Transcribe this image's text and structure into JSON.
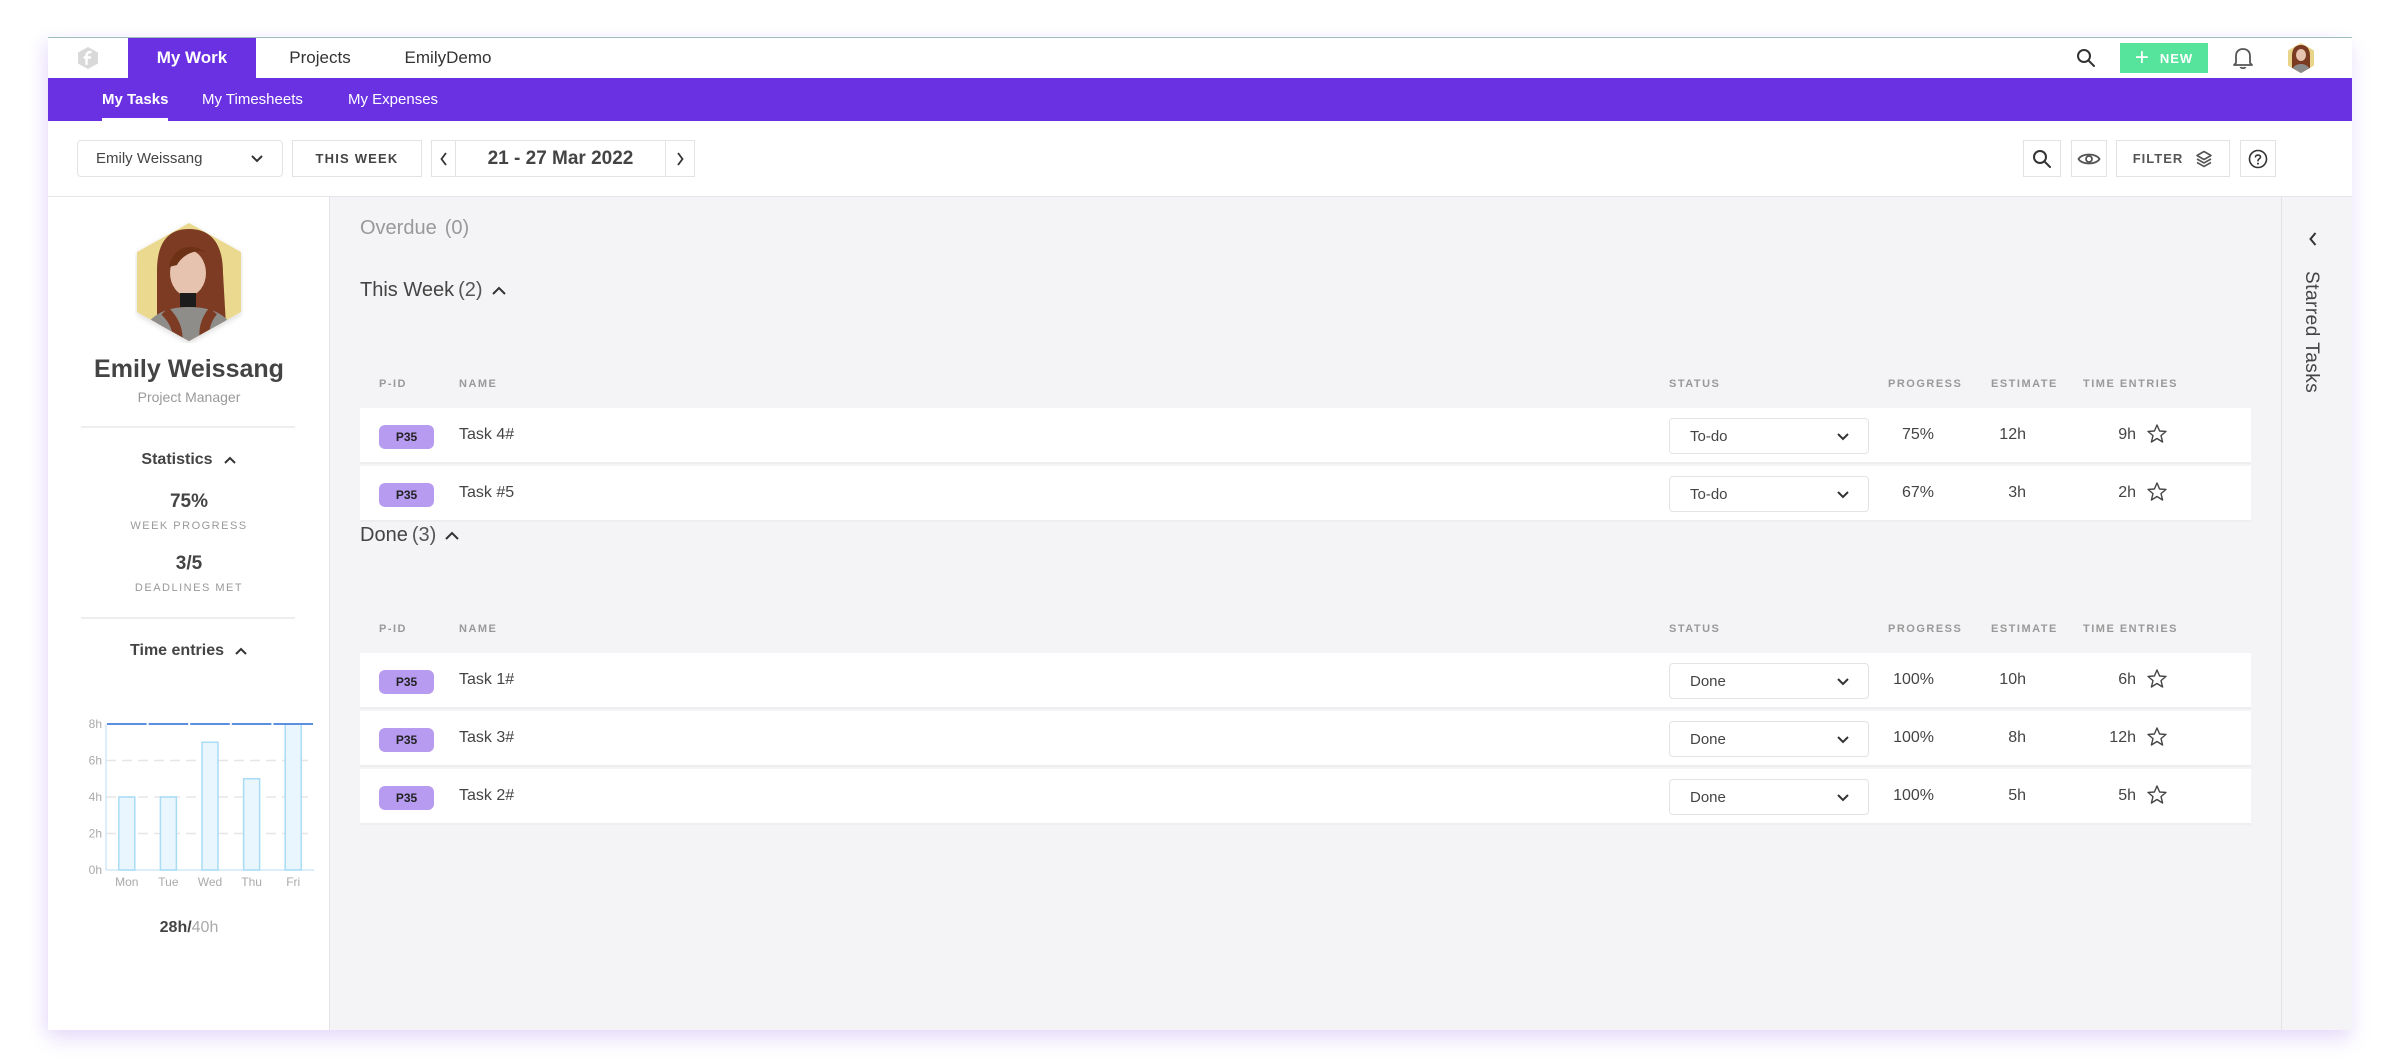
{
  "topnav": {
    "tabs": [
      {
        "label": "My Work",
        "active": true
      },
      {
        "label": "Projects",
        "active": false
      },
      {
        "label": "EmilyDemo",
        "active": false
      }
    ],
    "new_label": "NEW",
    "icons": [
      "search-icon",
      "plus-icon",
      "bell-icon",
      "user-avatar"
    ]
  },
  "subnav": {
    "tabs": [
      {
        "label": "My Tasks",
        "active": true
      },
      {
        "label": "My Timesheets",
        "active": false
      },
      {
        "label": "My Expenses",
        "active": false
      }
    ]
  },
  "toolbar": {
    "user_select": "Emily Weissang",
    "this_week_label": "THIS WEEK",
    "date_range": "21 - 27 Mar 2022",
    "filter_label": "FILTER"
  },
  "profile": {
    "name": "Emily Weissang",
    "role": "Project Manager",
    "statistics_title": "Statistics",
    "week_progress_value": "75%",
    "week_progress_label": "WEEK PROGRESS",
    "deadlines_value": "3/5",
    "deadlines_label": "DEADLINES MET",
    "time_entries_title": "Time entries",
    "total_logged": "28h/",
    "total_capacity": "40h"
  },
  "chart_data": {
    "type": "bar",
    "title": "Time entries",
    "categories": [
      "Mon",
      "Tue",
      "Wed",
      "Thu",
      "Fri"
    ],
    "values": [
      4,
      4,
      7,
      5,
      8
    ],
    "unit": "h",
    "yticks": [
      "0h",
      "2h",
      "4h",
      "6h",
      "8h"
    ],
    "ylim": [
      0,
      8
    ],
    "target_line": 8,
    "grid": true,
    "xlabel": "",
    "ylabel": ""
  },
  "main": {
    "overdue": {
      "title": "Overdue",
      "count": "(0)"
    },
    "columns": {
      "pid": "P-ID",
      "name": "NAME",
      "status": "STATUS",
      "progress": "PROGRESS",
      "estimate": "ESTIMATE",
      "time_entries": "TIME ENTRIES"
    },
    "this_week": {
      "title": "This Week",
      "count": "(2)",
      "rows": [
        {
          "pid": "P35",
          "name": "Task 4#",
          "status": "To-do",
          "progress": "75%",
          "estimate": "12h",
          "time_entries": "9h"
        },
        {
          "pid": "P35",
          "name": "Task #5",
          "status": "To-do",
          "progress": "67%",
          "estimate": "3h",
          "time_entries": "2h"
        }
      ]
    },
    "done": {
      "title": "Done",
      "count": "(3)",
      "rows": [
        {
          "pid": "P35",
          "name": "Task 1#",
          "status": "Done",
          "progress": "100%",
          "estimate": "10h",
          "time_entries": "6h"
        },
        {
          "pid": "P35",
          "name": "Task 3#",
          "status": "Done",
          "progress": "100%",
          "estimate": "8h",
          "time_entries": "12h"
        },
        {
          "pid": "P35",
          "name": "Task 2#",
          "status": "Done",
          "progress": "100%",
          "estimate": "5h",
          "time_entries": "5h"
        }
      ]
    }
  },
  "starred": {
    "label": "Starred Tasks"
  },
  "colors": {
    "brand_purple": "#6a31e2",
    "new_green": "#56e39c",
    "badge_purple": "#b69bf0",
    "bar_fill": "#eaf6fd",
    "bar_stroke": "#a8dcf5",
    "target_line": "#5b8fe0"
  }
}
